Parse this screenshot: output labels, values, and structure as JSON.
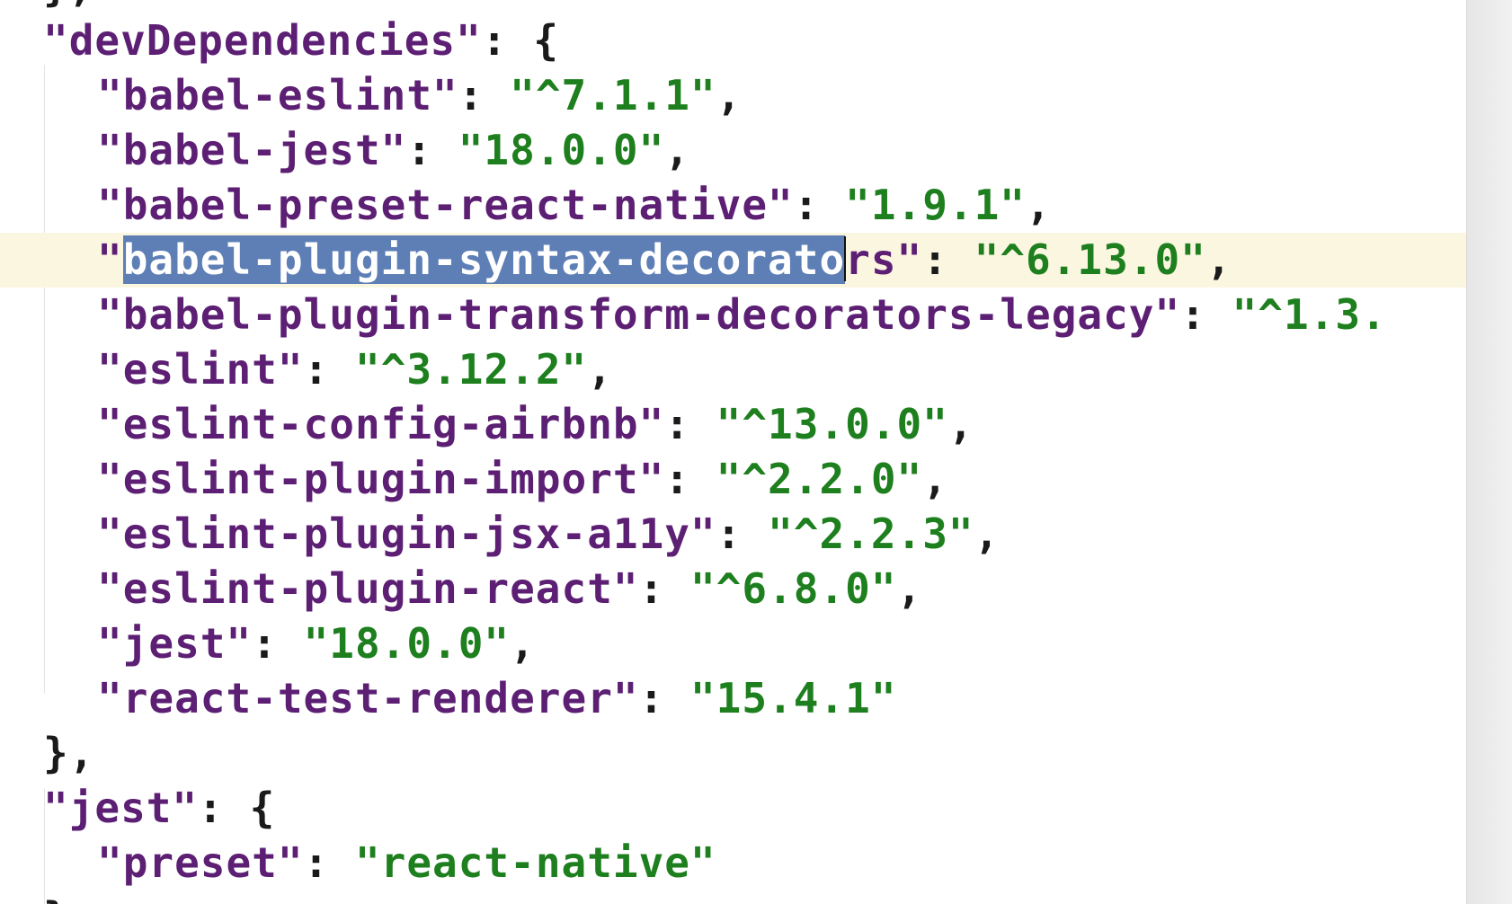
{
  "editor": {
    "top_partial": "},",
    "lines": [
      {
        "id": "devDependencies-open",
        "key": "\"devDependencies\"",
        "sep": ": ",
        "tail": "{"
      },
      {
        "id": "dep-babel-eslint",
        "key": "\"babel-eslint\"",
        "sep": ": ",
        "value": "\"^7.1.1\"",
        "tail": ","
      },
      {
        "id": "dep-babel-jest",
        "key": "\"babel-jest\"",
        "sep": ": ",
        "value": "\"18.0.0\"",
        "tail": ","
      },
      {
        "id": "dep-babel-preset-react-native",
        "key": "\"babel-preset-react-native\"",
        "sep": ": ",
        "value": "\"1.9.1\"",
        "tail": ","
      },
      {
        "id": "dep-babel-plugin-syntax-decorators",
        "key_quote_open": "\"",
        "key_selected": "babel-plugin-syntax-decorato",
        "key_rest": "rs\"",
        "sep": ": ",
        "value": "\"^6.13.0\"",
        "tail": ","
      },
      {
        "id": "dep-babel-plugin-transform-decorators-legacy",
        "key": "\"babel-plugin-transform-decorators-legacy\"",
        "sep": ": ",
        "value": "\"^1.3.",
        "tail": ""
      },
      {
        "id": "dep-eslint",
        "key": "\"eslint\"",
        "sep": ": ",
        "value": "\"^3.12.2\"",
        "tail": ","
      },
      {
        "id": "dep-eslint-config-airbnb",
        "key": "\"eslint-config-airbnb\"",
        "sep": ": ",
        "value": "\"^13.0.0\"",
        "tail": ","
      },
      {
        "id": "dep-eslint-plugin-import",
        "key": "\"eslint-plugin-import\"",
        "sep": ": ",
        "value": "\"^2.2.0\"",
        "tail": ","
      },
      {
        "id": "dep-eslint-plugin-jsx-a11y",
        "key": "\"eslint-plugin-jsx-a11y\"",
        "sep": ": ",
        "value": "\"^2.2.3\"",
        "tail": ","
      },
      {
        "id": "dep-eslint-plugin-react",
        "key": "\"eslint-plugin-react\"",
        "sep": ": ",
        "value": "\"^6.8.0\"",
        "tail": ","
      },
      {
        "id": "dep-jest",
        "key": "\"jest\"",
        "sep": ": ",
        "value": "\"18.0.0\"",
        "tail": ","
      },
      {
        "id": "dep-react-test-renderer",
        "key": "\"react-test-renderer\"",
        "sep": ": ",
        "value": "\"15.4.1\"",
        "tail": ""
      },
      {
        "id": "devDependencies-close",
        "tail": "},"
      },
      {
        "id": "jest-open",
        "key": "\"jest\"",
        "sep": ": ",
        "tail": "{"
      },
      {
        "id": "jest-preset",
        "key": "\"preset\"",
        "sep": ": ",
        "value": "\"react-native\"",
        "tail": ""
      },
      {
        "id": "jest-close",
        "tail": "}"
      }
    ]
  },
  "colors": {
    "key": "#5c1f74",
    "string": "#1e7f1e",
    "selection": "#5d7fb6",
    "current_line": "#fbf6e0"
  },
  "icons": {
    "gutter_marker": "lightbulb-icon"
  }
}
